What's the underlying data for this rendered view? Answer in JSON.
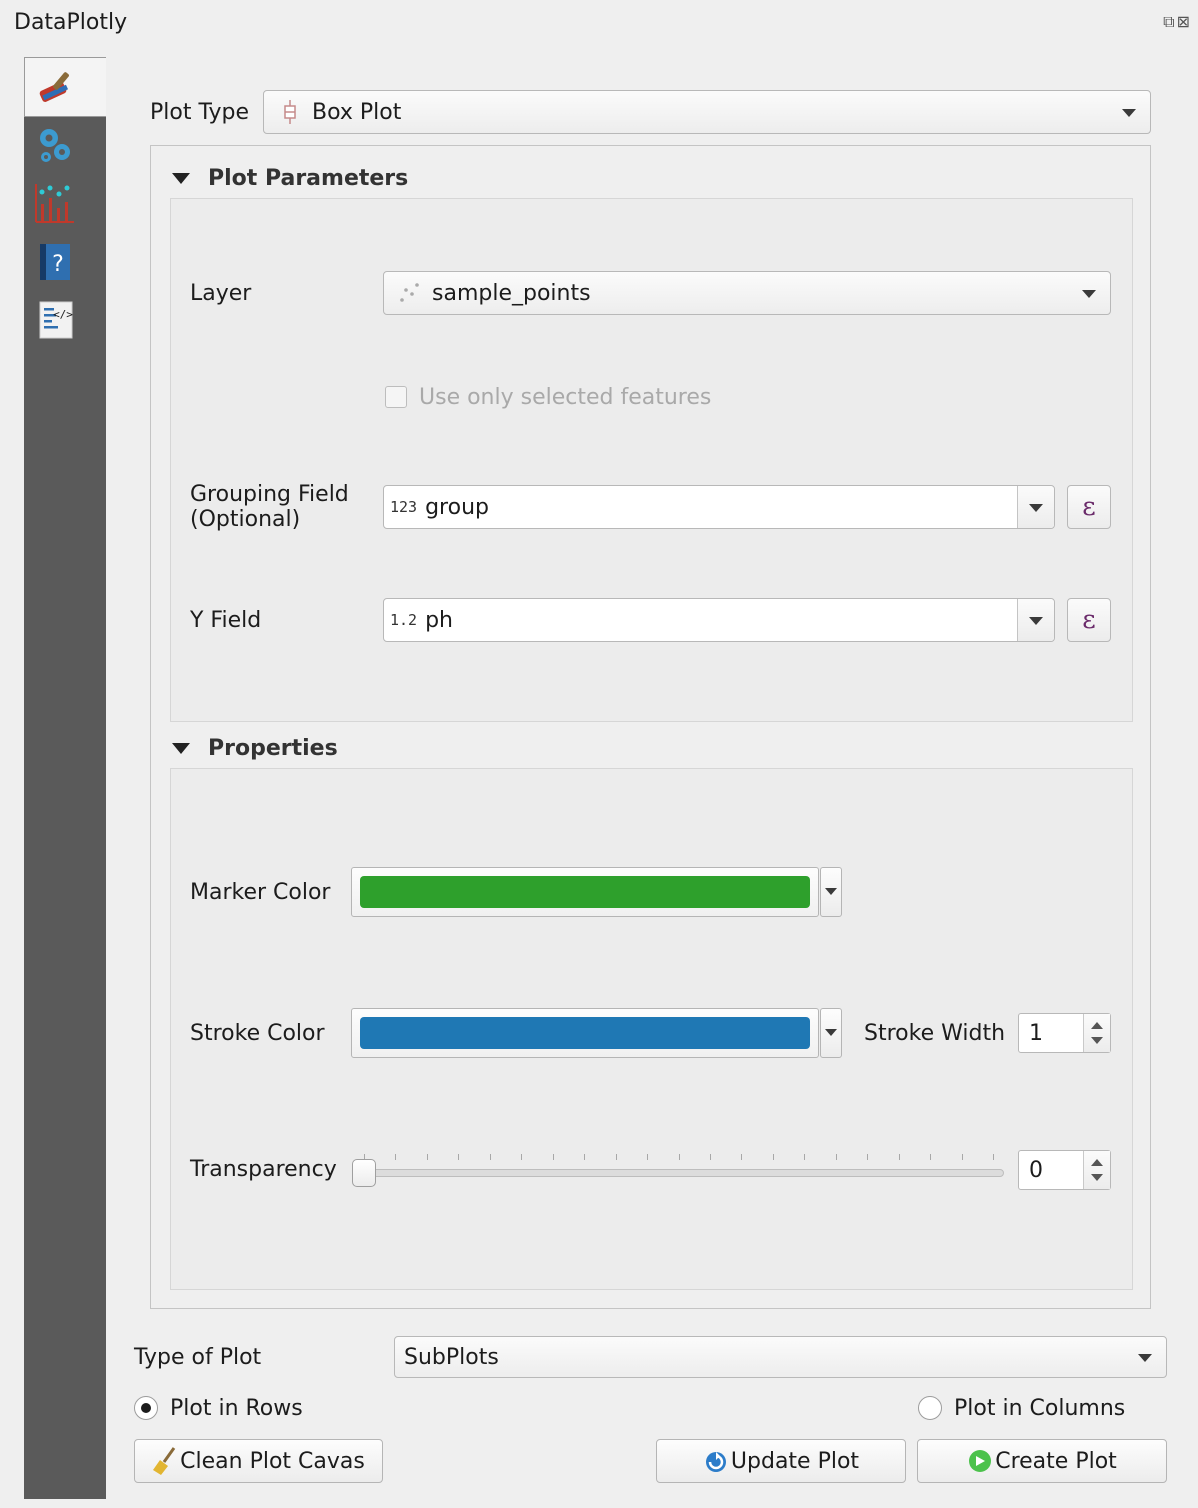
{
  "window": {
    "title": "DataPlotly"
  },
  "sidebar": {
    "tabs": [
      {
        "icon": "paintbrush-icon"
      },
      {
        "icon": "gears-icon"
      },
      {
        "icon": "scatter-bars-icon"
      },
      {
        "icon": "help-book-icon"
      },
      {
        "icon": "code-document-icon"
      }
    ]
  },
  "plot_type": {
    "label": "Plot Type",
    "value": "Box Plot"
  },
  "plot_parameters": {
    "heading": "Plot Parameters",
    "layer_label": "Layer",
    "layer_value": "sample_points",
    "selected_only_label": "Use only selected features",
    "grouping_label_line1": "Grouping Field",
    "grouping_label_line2": "(Optional)",
    "grouping_prefix": "123",
    "grouping_value": "group",
    "y_label": "Y Field",
    "y_prefix": "1.2",
    "y_value": "ph",
    "expression_symbol": "ε"
  },
  "properties": {
    "heading": "Properties",
    "marker_color_label": "Marker Color",
    "marker_color": "#2ea02c",
    "stroke_color_label": "Stroke Color",
    "stroke_color": "#1f78b4",
    "stroke_width_label": "Stroke Width",
    "stroke_width": "1",
    "transparency_label": "Transparency",
    "transparency": "0"
  },
  "bottom": {
    "type_of_plot_label": "Type of Plot",
    "type_of_plot_value": "SubPlots",
    "plot_in_rows": "Plot in Rows",
    "plot_in_columns": "Plot in Columns",
    "clean_button": "Clean Plot Cavas",
    "update_button": "Update Plot",
    "create_button": "Create Plot"
  }
}
